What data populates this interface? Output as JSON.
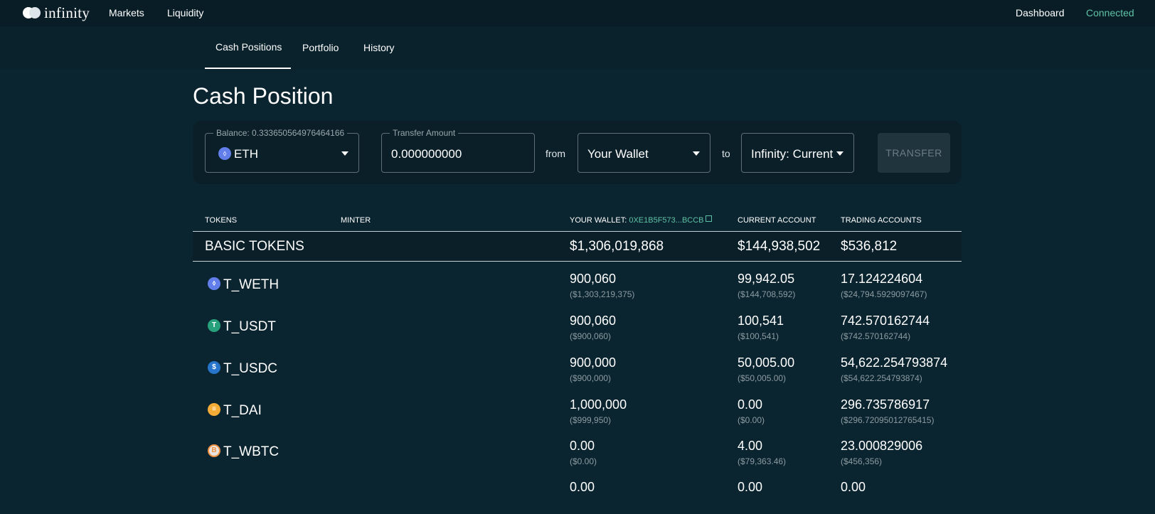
{
  "topbar": {
    "logo_text": "infinity",
    "nav": {
      "markets": "Markets",
      "liquidity": "Liquidity",
      "dashboard": "Dashboard",
      "connected": "Connected"
    }
  },
  "subnav": {
    "tabs": [
      "Cash Positions",
      "Portfolio",
      "History"
    ],
    "active": "Cash Positions"
  },
  "page_title": "Cash Position",
  "transfer": {
    "balance_label": "Balance: 0.333650564976464166",
    "token": "ETH",
    "amount_label": "Transfer Amount",
    "amount_value": "0.000000000",
    "from_text": "from",
    "from_value": "Your Wallet",
    "to_text": "to",
    "to_value": "Infinity: Current",
    "button_label": "TRANSFER"
  },
  "table": {
    "headers": {
      "tokens": "TOKENS",
      "minter": "MINTER",
      "wallet_prefix": "YOUR WALLET: ",
      "wallet_address": "0XE1B5F573...BCCB",
      "current": "CURRENT ACCOUNT",
      "trading": "TRADING ACCOUNTS"
    },
    "group": {
      "name": "BASIC TOKENS",
      "wallet": "$1,306,019,868",
      "current": "$144,938,502",
      "trading": "$536,812"
    },
    "rows": [
      {
        "icon": "eth-icon",
        "glyph": "⬨",
        "color": "#627eea",
        "name": "T_WETH",
        "wallet": "900,060",
        "wallet_usd": "($1,303,219,375)",
        "current": "99,942.05",
        "current_usd": "($144,708,592)",
        "trading": "17.124224604",
        "trading_usd": "($24,794.5929097467)"
      },
      {
        "icon": "usdt-icon",
        "glyph": "T",
        "color": "#26a17b",
        "name": "T_USDT",
        "wallet": "900,060",
        "wallet_usd": "($900,060)",
        "current": "100,541",
        "current_usd": "($100,541)",
        "trading": "742.570162744",
        "trading_usd": "($742.570162744)"
      },
      {
        "icon": "usdc-icon",
        "glyph": "$",
        "color": "#2775ca",
        "name": "T_USDC",
        "wallet": "900,000",
        "wallet_usd": "($900,000)",
        "current": "50,005.00",
        "current_usd": "($50,005.00)",
        "trading": "54,622.254793874",
        "trading_usd": "($54,622.254793874)"
      },
      {
        "icon": "dai-icon",
        "glyph": "≡",
        "color": "#f5ac37",
        "name": "T_DAI",
        "wallet": "1,000,000",
        "wallet_usd": "($999,950)",
        "current": "0.00",
        "current_usd": "($0.00)",
        "trading": "296.735786917",
        "trading_usd": "($296.72095012765415)"
      },
      {
        "icon": "wbtc-icon",
        "glyph": "B",
        "color": "#e9e4df",
        "name": "T_WBTC",
        "wallet": "0.00",
        "wallet_usd": "($0.00)",
        "current": "4.00",
        "current_usd": "($79,363.46)",
        "trading": "23.000829006",
        "trading_usd": "($456,356)"
      },
      {
        "icon": "token-icon",
        "glyph": "",
        "color": "#0b2530",
        "name": "",
        "wallet": "0.00",
        "wallet_usd": "",
        "current": "0.00",
        "current_usd": "",
        "trading": "0.00",
        "trading_usd": ""
      }
    ]
  }
}
